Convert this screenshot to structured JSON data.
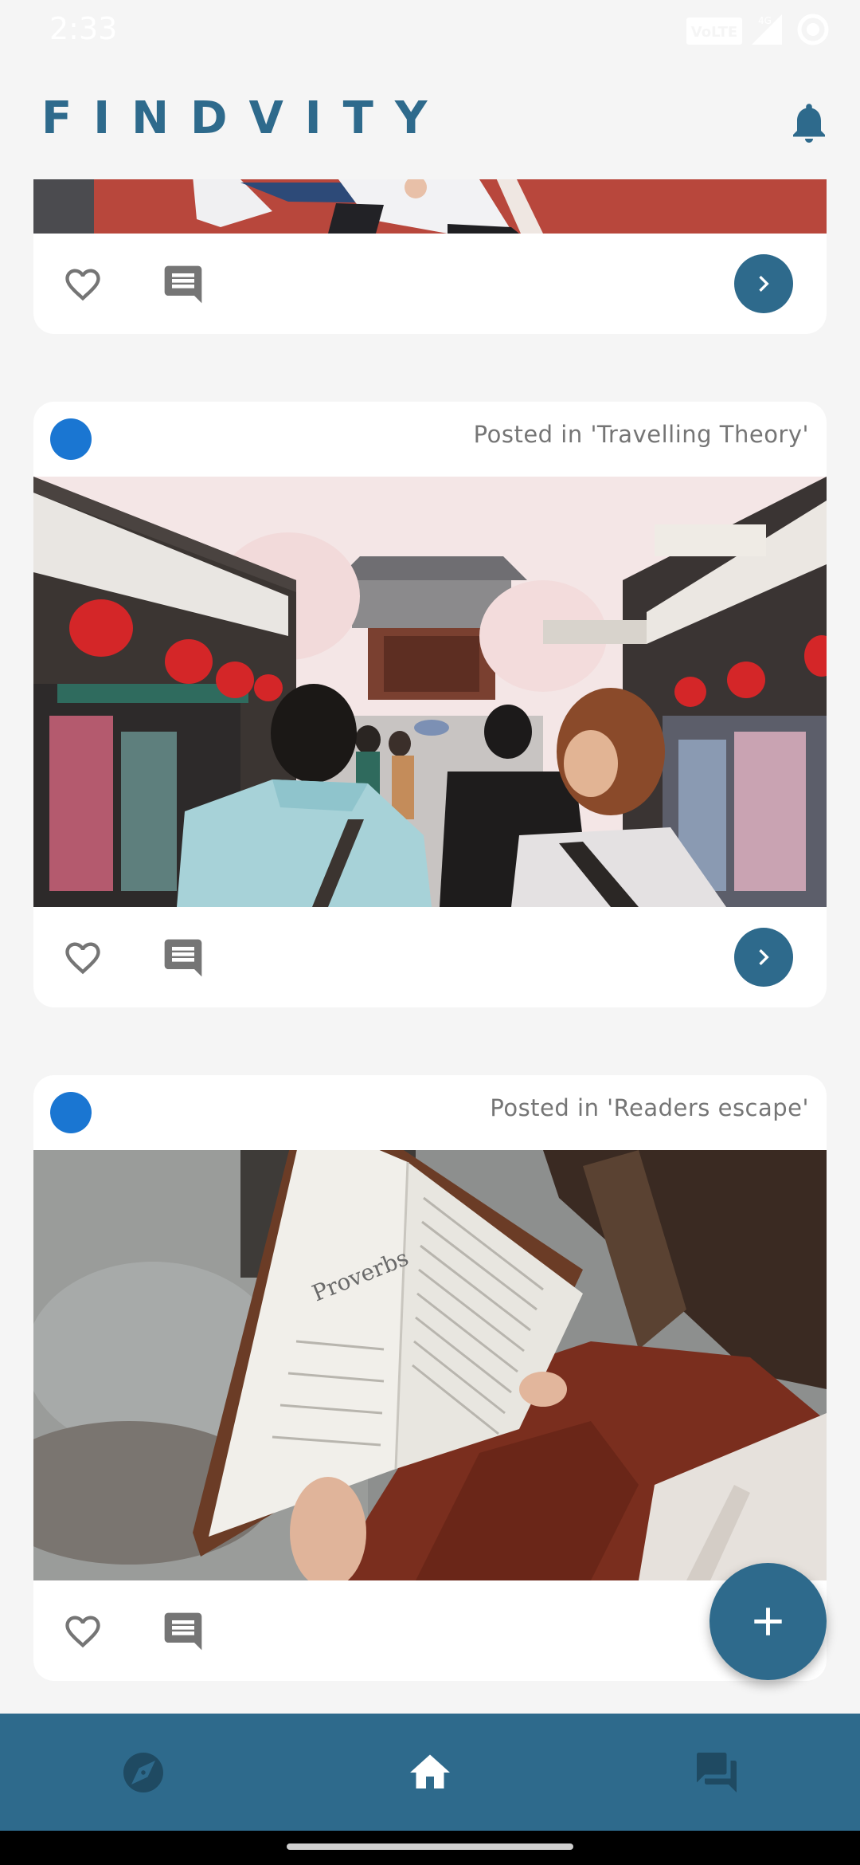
{
  "status_bar": {
    "time": "2:33",
    "network_label": "VoLTE",
    "signal_label": "4G",
    "icons": [
      "volte-icon",
      "signal-icon",
      "data-saver-icon"
    ]
  },
  "header": {
    "logo_text": "FINDVITY",
    "icons": [
      "notification-bell-icon"
    ]
  },
  "feed": {
    "posts": [
      {
        "posted_in": "",
        "image_alt": "baseball player on field",
        "actions": [
          "like",
          "comment",
          "open"
        ]
      },
      {
        "posted_in": "Posted in 'Travelling Theory'",
        "image_alt": "crowded market street with red lanterns and temple",
        "actions": [
          "like",
          "comment",
          "open"
        ]
      },
      {
        "posted_in": "Posted in 'Readers escape'",
        "image_alt": "woman reading a book open to Proverbs",
        "book_text": "Proverbs",
        "actions": [
          "like",
          "comment"
        ]
      }
    ]
  },
  "fab": {
    "icon": "plus-icon"
  },
  "bottom_nav": {
    "items": [
      {
        "id": "explore",
        "icon": "compass-icon",
        "active": false
      },
      {
        "id": "home",
        "icon": "home-icon",
        "active": true
      },
      {
        "id": "chat",
        "icon": "chat-icon",
        "active": false
      }
    ]
  },
  "colors": {
    "brand": "#2e6a8c",
    "avatar": "#1a76d2",
    "background": "#f5f5f5",
    "card": "#ffffff",
    "muted_text": "#757575",
    "icon_gray": "#757575",
    "nav_inactive": "#1f4a62",
    "nav_active": "#ffffff"
  }
}
